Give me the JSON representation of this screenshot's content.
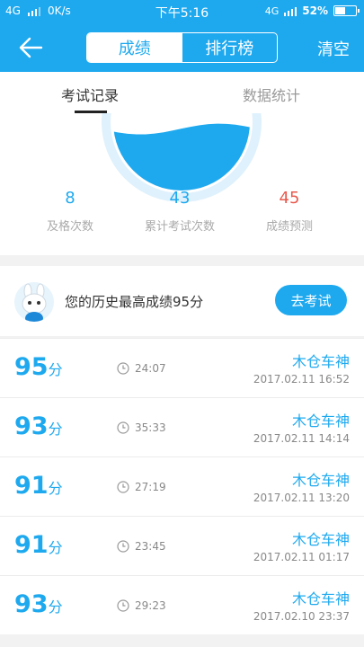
{
  "status_bar": {
    "network": "4G",
    "speed": "0K/s",
    "time": "下午5:16",
    "network_right": "4G",
    "battery": "52%",
    "battery_level": 0.52
  },
  "nav": {
    "back_icon": "arrow-left-icon",
    "tabs": [
      "成绩",
      "排行榜"
    ],
    "active_tab": 0,
    "clear_label": "清空"
  },
  "sub_tabs": {
    "items": [
      "考试记录",
      "数据统计"
    ],
    "active": 0
  },
  "summary": {
    "gauge_level": 0.45,
    "stats": [
      {
        "value": "8",
        "label": "及格次数",
        "color": "#1ea9ef"
      },
      {
        "value": "43",
        "label": "累计考试次数",
        "color": "#1ea9ef"
      },
      {
        "value": "45",
        "label": "成绩预测",
        "color": "#e8594e"
      }
    ]
  },
  "history": {
    "text": "您的历史最高成绩95分",
    "button": "去考试"
  },
  "records": [
    {
      "score": "95",
      "unit": "分",
      "duration": "24:07",
      "title": "木仓车神",
      "date": "2017.02.11  16:52"
    },
    {
      "score": "93",
      "unit": "分",
      "duration": "35:33",
      "title": "木仓车神",
      "date": "2017.02.11  14:14"
    },
    {
      "score": "91",
      "unit": "分",
      "duration": "27:19",
      "title": "木仓车神",
      "date": "2017.02.11  13:20"
    },
    {
      "score": "91",
      "unit": "分",
      "duration": "23:45",
      "title": "木仓车神",
      "date": "2017.02.11  01:17"
    },
    {
      "score": "93",
      "unit": "分",
      "duration": "29:23",
      "title": "木仓车神",
      "date": "2017.02.10  23:37"
    }
  ],
  "colors": {
    "accent": "#1ea9ef",
    "danger": "#e8594e"
  }
}
